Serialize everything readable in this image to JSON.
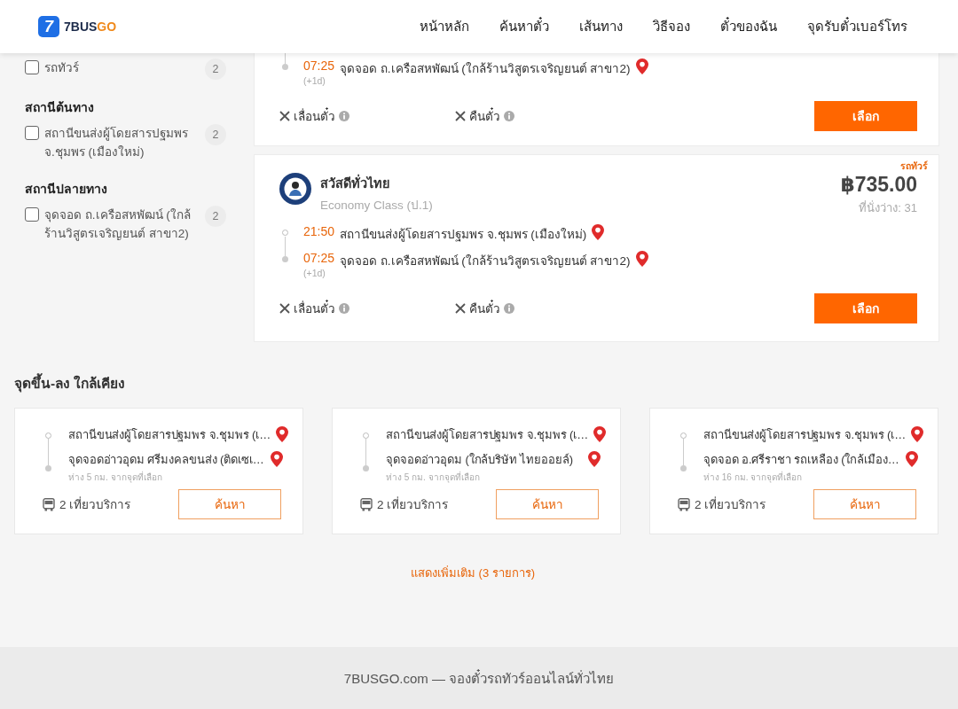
{
  "header": {
    "logo": {
      "icon_text": "7",
      "text_main": "7BUS",
      "text_accent": "GO"
    },
    "nav": [
      {
        "label": "หน้าหลัก"
      },
      {
        "label": "ค้นหาตั๋ว"
      },
      {
        "label": "เส้นทาง"
      },
      {
        "label": "วิธีจอง"
      },
      {
        "label": "ตั๋วของฉัน"
      },
      {
        "label": "จุดรับตั๋วเบอร์โทร"
      }
    ]
  },
  "sidebar": {
    "filter_groups": [
      {
        "items": [
          {
            "label": "รถทัวร์",
            "count": "2",
            "checked": false
          }
        ]
      },
      {
        "title": "สถานีต้นทาง",
        "items": [
          {
            "label": "สถานีขนส่งผู้โดยสารปฐมพร จ.ชุมพร (เมืองใหม่)",
            "count": "2",
            "checked": false
          }
        ]
      },
      {
        "title": "สถานีปลายทาง",
        "items": [
          {
            "label": "จุดจอด ถ.เครือสหพัฒน์ (ใกล้ร้านวิสูตรเจริญยนต์ สาขา2)",
            "count": "2",
            "checked": false
          }
        ]
      }
    ]
  },
  "trips": [
    {
      "stops": [
        {
          "kind": "arrival",
          "time": "07:25",
          "place": "จุดจอด ถ.เครือสหพัฒน์ (ใกล้ร้านวิสูตรเจริญยนต์ สาขา2)",
          "day_offset": "(+1d)"
        }
      ],
      "policies": [
        {
          "label": "เลื่อนตั๋ว",
          "allowed": false
        },
        {
          "label": "คืนตั๋ว",
          "allowed": false
        }
      ],
      "button": "เลือก"
    },
    {
      "tag": "รถทัวร์",
      "operator": "สวัสดีทั่วไทย",
      "class": "Economy Class (ป.1)",
      "price": "฿735.00",
      "seats": "ที่นั่งว่าง: 31",
      "stops": [
        {
          "kind": "departure",
          "time": "21:50",
          "place": "สถานีขนส่งผู้โดยสารปฐมพร จ.ชุมพร (เมืองใหม่)"
        },
        {
          "kind": "arrival",
          "time": "07:25",
          "place": "จุดจอด ถ.เครือสหพัฒน์ (ใกล้ร้านวิสูตรเจริญยนต์ สาขา2)",
          "day_offset": "(+1d)"
        }
      ],
      "policies": [
        {
          "label": "เลื่อนตั๋ว",
          "allowed": false
        },
        {
          "label": "คืนตั๋ว",
          "allowed": false
        }
      ],
      "button": "เลือก"
    }
  ],
  "nearby": {
    "title": "จุดขึ้น-ลง ใกล้เคียง",
    "cards": [
      {
        "from": "สถานีขนส่งผู้โดยสารปฐมพร จ.ชุมพร (เ…",
        "to": "จุดจอดอ่าวอุดม ศรีมงคลขนส่ง (ติดเซเ…",
        "distance": "ห่าง 5 กม. จากจุดที่เลือก",
        "trips": "2 เที่ยวบริการ",
        "button": "ค้นหา"
      },
      {
        "from": "สถานีขนส่งผู้โดยสารปฐมพร จ.ชุมพร (เ…",
        "to": "จุดจอดอ่าวอุดม (ใกล้บริษัท ไทยออยล์)",
        "distance": "ห่าง 5 กม. จากจุดที่เลือก",
        "trips": "2 เที่ยวบริการ",
        "button": "ค้นหา"
      },
      {
        "from": "สถานีขนส่งผู้โดยสารปฐมพร จ.ชุมพร (เ…",
        "to": "จุดจอด อ.ศรีราชา รถเหลือง (ใกล้เมือง…",
        "distance": "ห่าง 16 กม. จากจุดที่เลือก",
        "trips": "2 เที่ยวบริการ",
        "button": "ค้นหา"
      }
    ],
    "show_more": "แสดงเพิ่มเติม (3 รายการ)"
  },
  "footer": {
    "text": "7BUSGO.com — จองตั๋วรถทัวร์ออนไลน์ทั่วไทย"
  }
}
